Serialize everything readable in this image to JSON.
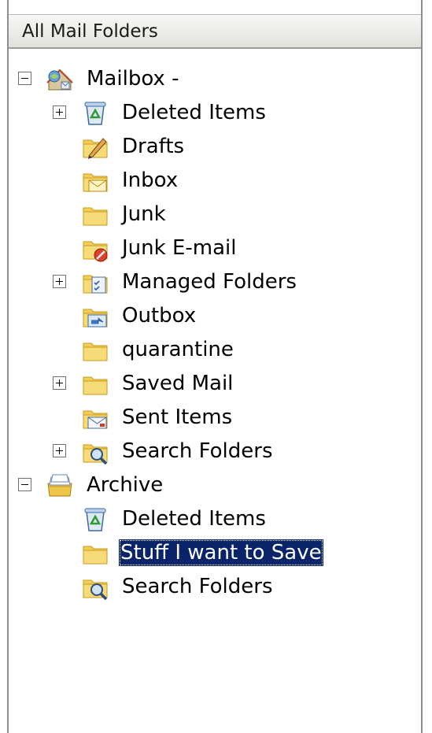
{
  "header": {
    "title": "All Mail Folders"
  },
  "tree": {
    "mailbox": {
      "label": "Mailbox -",
      "children": [
        {
          "label": "Deleted Items"
        },
        {
          "label": "Drafts"
        },
        {
          "label": "Inbox"
        },
        {
          "label": "Junk"
        },
        {
          "label": "Junk E-mail"
        },
        {
          "label": "Managed Folders"
        },
        {
          "label": "Outbox"
        },
        {
          "label": "quarantine"
        },
        {
          "label": "Saved Mail"
        },
        {
          "label": "Sent Items"
        },
        {
          "label": "Search Folders"
        }
      ]
    },
    "archive": {
      "label": "Archive",
      "children": [
        {
          "label": "Deleted Items"
        },
        {
          "label": "Stuff I want to Save",
          "selected": true
        },
        {
          "label": "Search Folders"
        }
      ]
    }
  },
  "colors": {
    "selection": "#0a246a",
    "folder": "#f3cf58",
    "folder_dark": "#c99a1c"
  }
}
